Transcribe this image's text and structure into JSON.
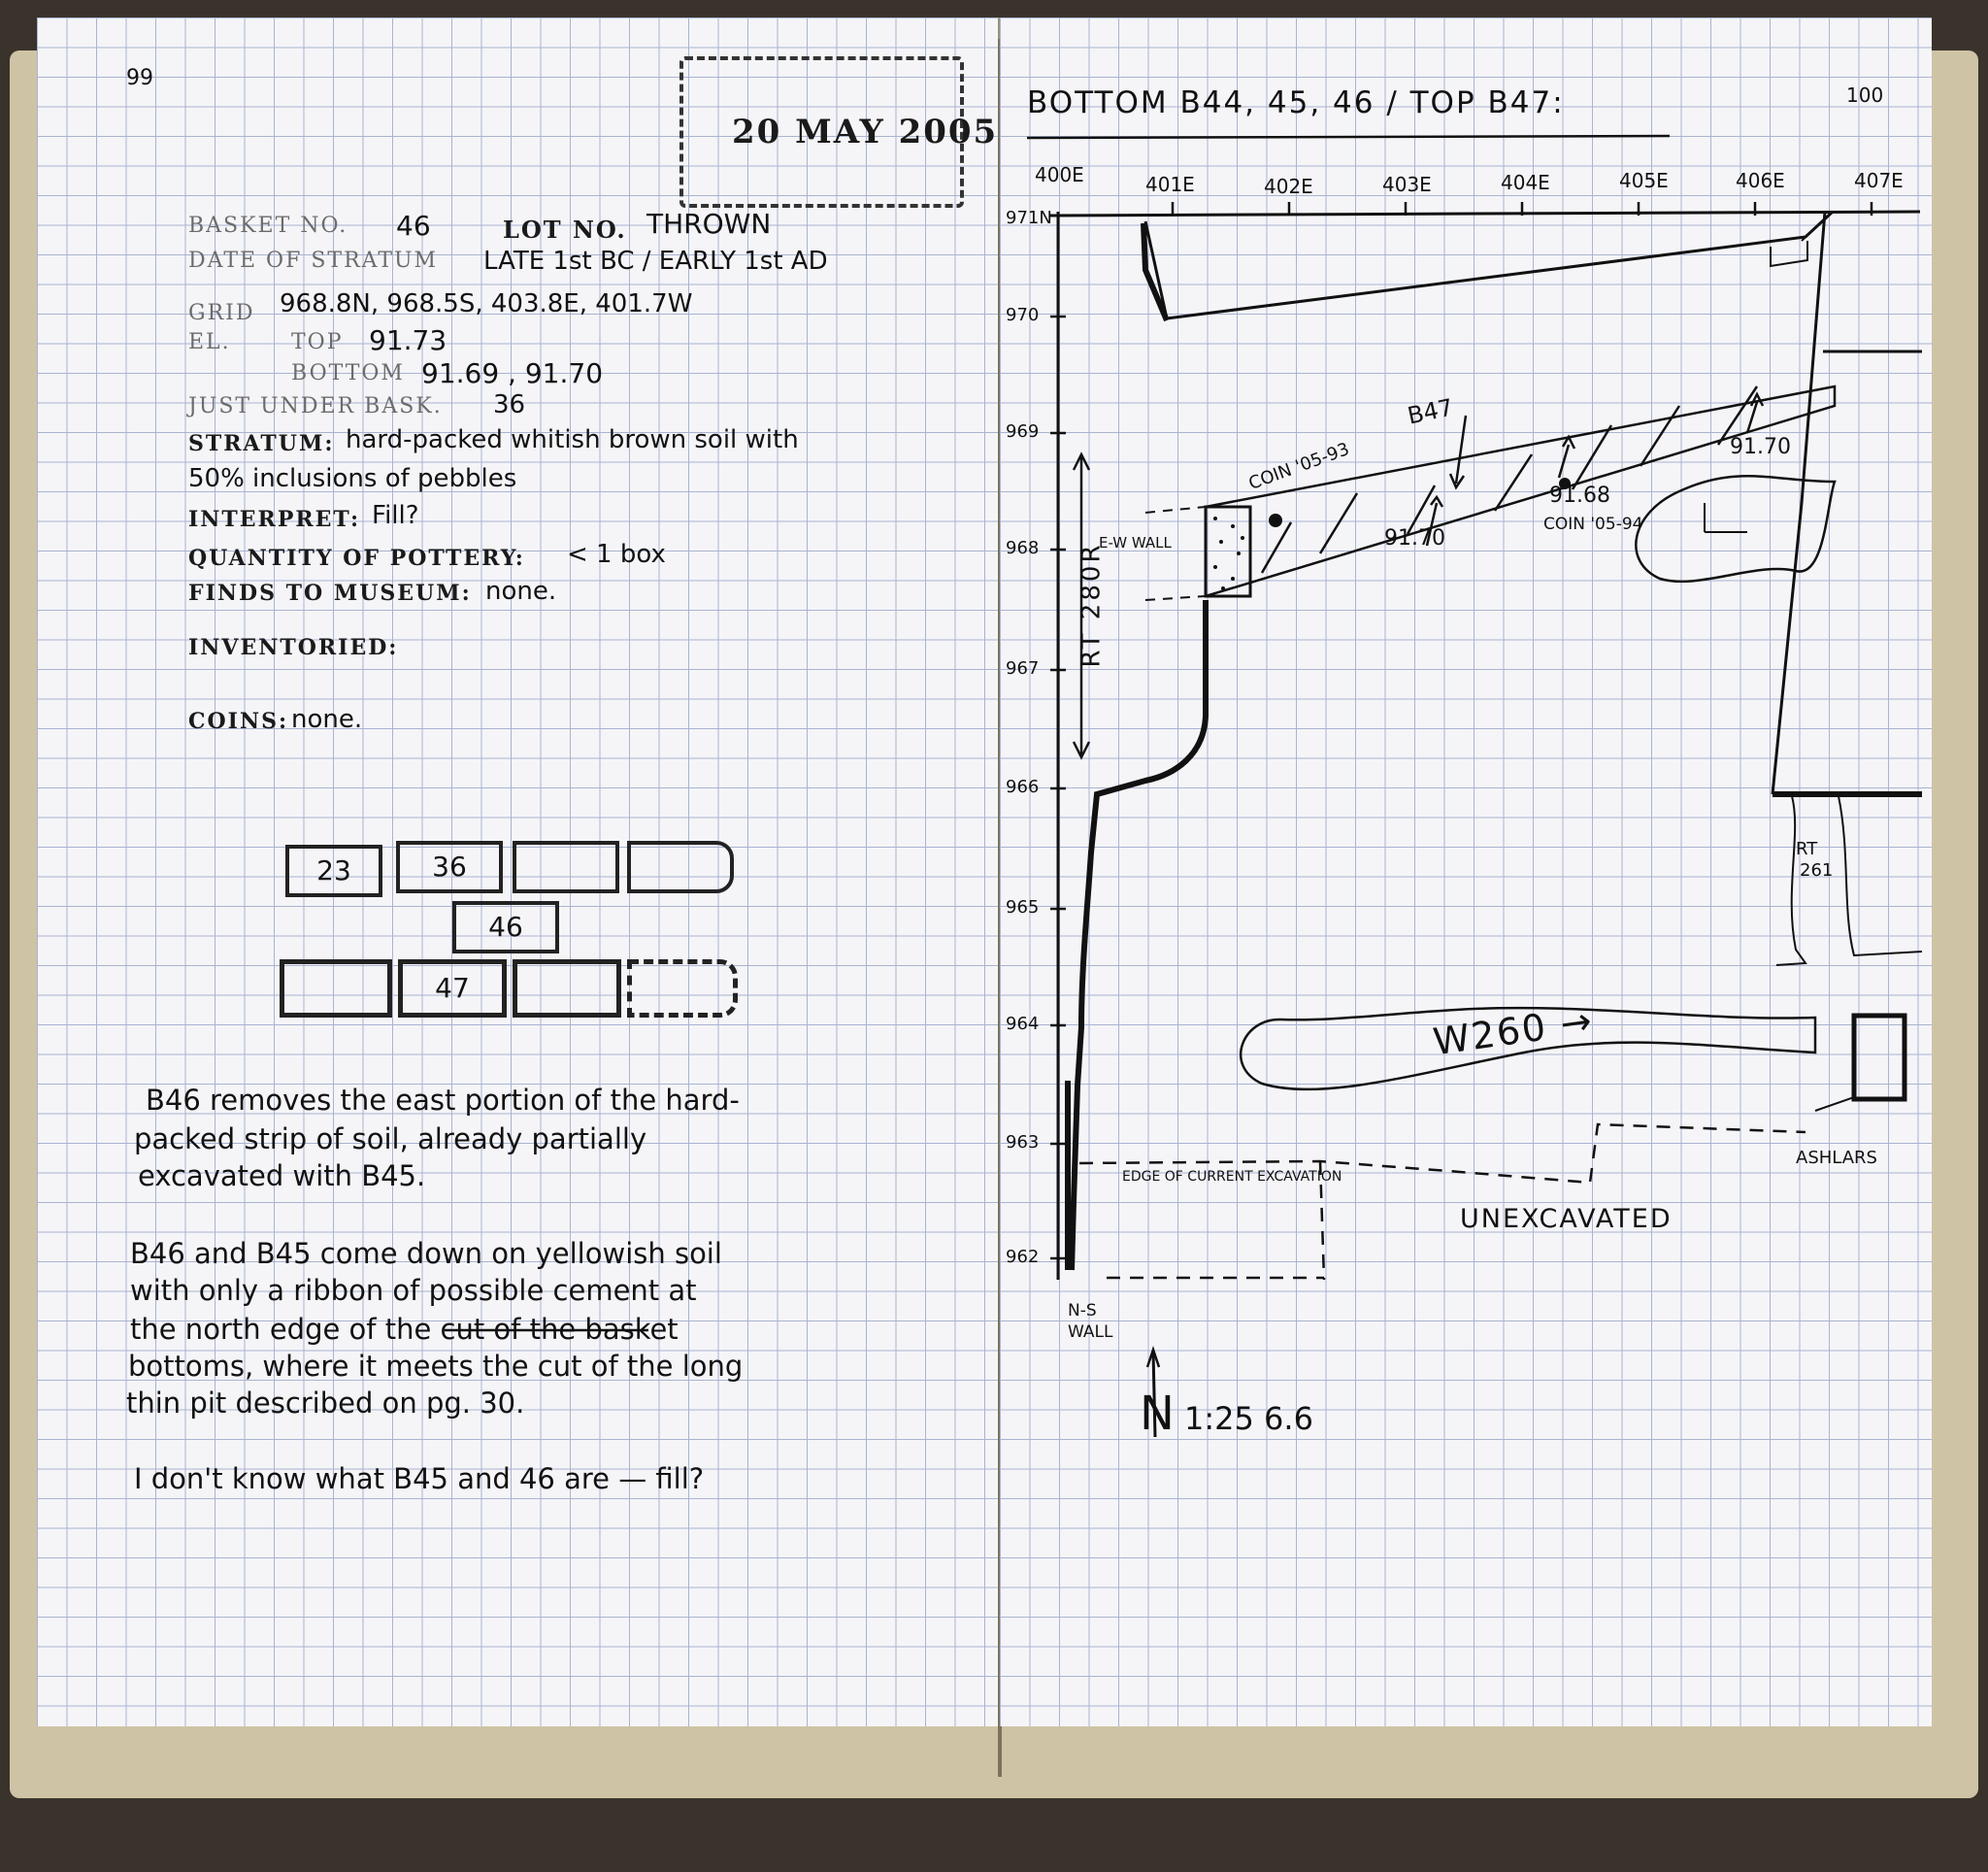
{
  "left_page": {
    "page_number": "99",
    "date_stamp": "20 MAY 2005",
    "basket_label": "BASKET NO.",
    "basket_value": "46",
    "lot_label": "LOT NO.",
    "lot_value": "THROWN",
    "date_stratum_label": "DATE OF STRATUM",
    "date_stratum_value": "LATE 1st BC / EARLY 1st AD",
    "grid_label": "GRID",
    "grid_value": "968.8N, 968.5S, 403.8E, 401.7W",
    "el_label": "EL.",
    "top_label": "TOP",
    "top_value": "91.73",
    "bottom_label": "BOTTOM",
    "bottom_value": "91.69 , 91.70",
    "under_label": "JUST UNDER BASK.",
    "under_value": "36",
    "stratum_label": "STRATUM:",
    "stratum_line1": "hard-packed whitish brown soil with",
    "stratum_line2": "50% inclusions of pebbles",
    "interpret_label": "INTERPRET:",
    "interpret_value": "Fill?",
    "pottery_label": "QUANTITY OF POTTERY:",
    "pottery_value": "< 1 box",
    "finds_label": "FINDS TO MUSEUM:",
    "finds_value": "none.",
    "inventoried_label": "INVENTORIED:",
    "coins_label": "COINS:",
    "coins_value": "none.",
    "basket_boxes": [
      "23",
      "36",
      "",
      "",
      "46",
      "",
      "47",
      "",
      ""
    ],
    "notes": [
      "B46 removes the east portion of the hard-",
      "packed strip of soil, already partially",
      "excavated with B45.",
      "B46 and B45 come down on yellowish soil",
      "with only a ribbon of possible cement at",
      "the north edge of the cut of the basket",
      "bottoms, where it meets the cut of the long",
      "thin pit described on pg. 30.",
      "I don't know what B45 and 46 are — fill?"
    ]
  },
  "right_page": {
    "page_number": "100",
    "title": "BOTTOM B44, 45, 46 / TOP B47:",
    "x_labels": [
      "400E",
      "401E",
      "402E",
      "403E",
      "404E",
      "405E",
      "406E",
      "407E"
    ],
    "y_labels": [
      "971N",
      "970",
      "969",
      "968",
      "967",
      "966",
      "965",
      "964",
      "963",
      "962"
    ],
    "labels": {
      "rt": "RT 280R",
      "ew_wall": "E-W WALL",
      "b47": "B47",
      "coin1": "COIN '05-93",
      "coin2": "COIN '05-94",
      "el1": "91.70",
      "el2": "91.68",
      "el3": "91.70",
      "rt261_a": "RT",
      "rt261_b": "261",
      "w260": "W260 →",
      "edge": "EDGE OF CURRENT EXCAVATION",
      "unexcavated": "UNEXCAVATED",
      "ashlars": "ASHLARS",
      "ns_wall_a": "N-S",
      "ns_wall_b": "WALL",
      "north": "N",
      "scale": "1:25 6.6"
    }
  },
  "colors": {
    "ink": "#111111",
    "grid": "#a9b4d0",
    "paper": "#f5f5f8"
  }
}
